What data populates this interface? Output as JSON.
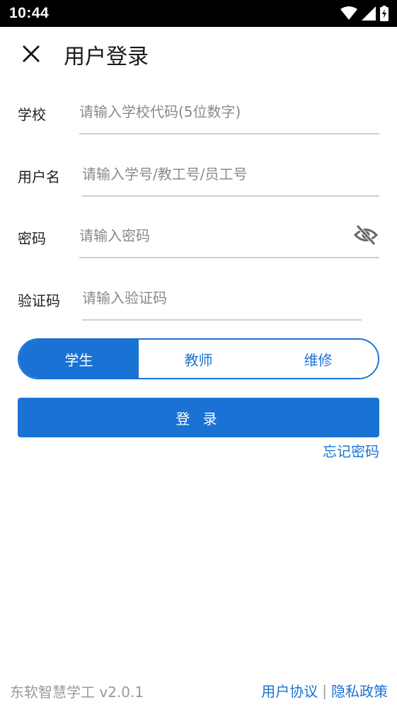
{
  "status_bar": {
    "time": "10:44",
    "icons": [
      "wifi-icon",
      "signal-icon",
      "battery-charging-icon"
    ]
  },
  "app_bar": {
    "close_icon": "close-icon",
    "title": "用户登录"
  },
  "form": {
    "school": {
      "label": "学校",
      "value": "",
      "placeholder": "请输入学校代码(5位数字)"
    },
    "username": {
      "label": "用户名",
      "value": "",
      "placeholder": "请输入学号/教工号/员工号"
    },
    "password": {
      "label": "密码",
      "value": "",
      "placeholder": "请输入密码",
      "toggle_icon": "eye-off-icon"
    },
    "captcha": {
      "label": "验证码",
      "value": "",
      "placeholder": "请输入验证码"
    }
  },
  "role_selector": {
    "options": [
      "学生",
      "教师",
      "维修"
    ],
    "selected": "学生"
  },
  "login_button": {
    "label": "登 录"
  },
  "forgot_password": {
    "label": "忘记密码"
  },
  "footer": {
    "version": "东软智慧学工 v2.0.1",
    "user_agreement": "用户协议",
    "separator": "|",
    "privacy_policy": "隐私政策"
  },
  "colors": {
    "accent": "#1a73d4",
    "status_bar_bg": "#000000",
    "placeholder": "#8a8a8a",
    "divider": "#cfcfcf"
  }
}
